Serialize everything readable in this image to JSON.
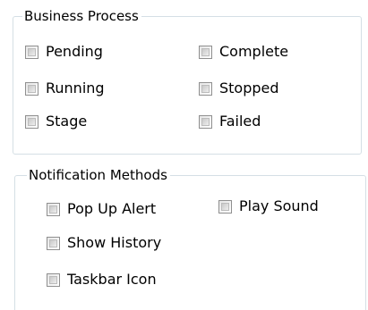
{
  "business_process": {
    "title": "Business Process",
    "items": [
      {
        "label": "Pending",
        "checked": false
      },
      {
        "label": "Complete",
        "checked": false
      },
      {
        "label": "Running",
        "checked": false
      },
      {
        "label": "Stopped",
        "checked": false
      },
      {
        "label": "Stage",
        "checked": false
      },
      {
        "label": "Failed",
        "checked": false
      }
    ]
  },
  "notification_methods": {
    "title": "Notification Methods",
    "items": [
      {
        "label": "Pop Up Alert",
        "checked": false
      },
      {
        "label": "Play Sound",
        "checked": false
      },
      {
        "label": "Show History",
        "checked": false
      },
      {
        "label": "Taskbar Icon",
        "checked": false
      }
    ]
  }
}
